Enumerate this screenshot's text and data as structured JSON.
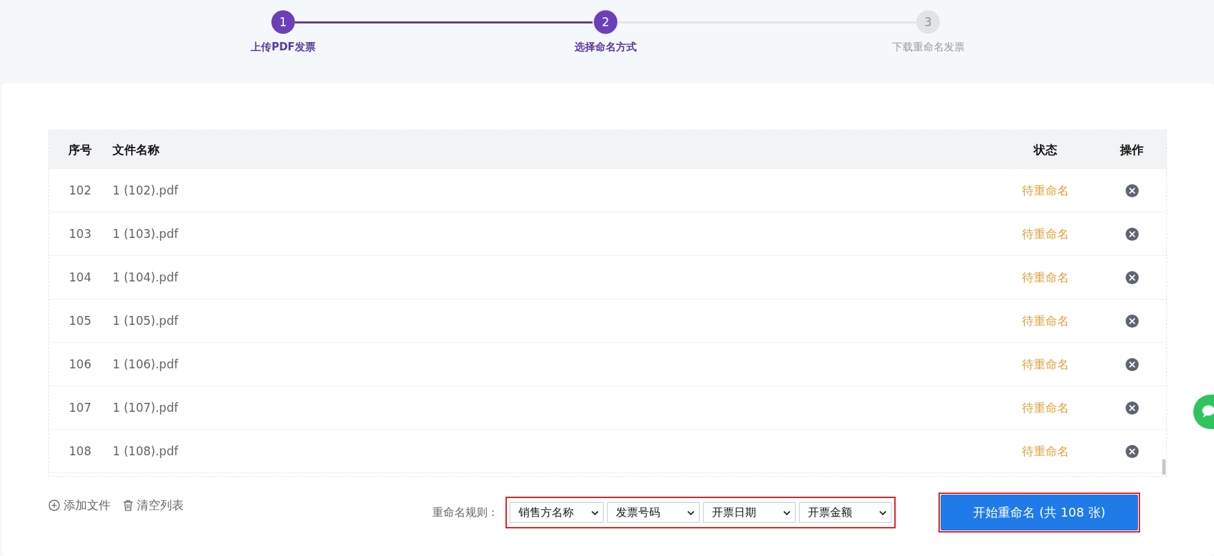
{
  "steps": [
    {
      "number": "1",
      "label": "上传PDF发票",
      "completed": true,
      "current": false
    },
    {
      "number": "2",
      "label": "选择命名方式",
      "completed": false,
      "current": true
    },
    {
      "number": "3",
      "label": "下载重命名发票",
      "completed": false,
      "current": false
    }
  ],
  "table": {
    "columns": [
      "序号",
      "文件名称",
      "状态",
      "操作"
    ],
    "rows": [
      {
        "index": "102",
        "file": "1 (102).pdf",
        "status": "待重命名"
      },
      {
        "index": "103",
        "file": "1 (103).pdf",
        "status": "待重命名"
      },
      {
        "index": "104",
        "file": "1 (104).pdf",
        "status": "待重命名"
      },
      {
        "index": "105",
        "file": "1 (105).pdf",
        "status": "待重命名"
      },
      {
        "index": "106",
        "file": "1 (106).pdf",
        "status": "待重命名"
      },
      {
        "index": "107",
        "file": "1 (107).pdf",
        "status": "待重命名"
      },
      {
        "index": "108",
        "file": "1 (108).pdf",
        "status": "待重命名"
      }
    ]
  },
  "actions": {
    "add": "添加文件",
    "clear": "清空列表"
  },
  "rule": {
    "label": "重命名规则：",
    "fields": [
      "销售方名称",
      "发票号码",
      "开票日期",
      "开票金额"
    ]
  },
  "start_button": "开始重命名 (共 108 张)"
}
